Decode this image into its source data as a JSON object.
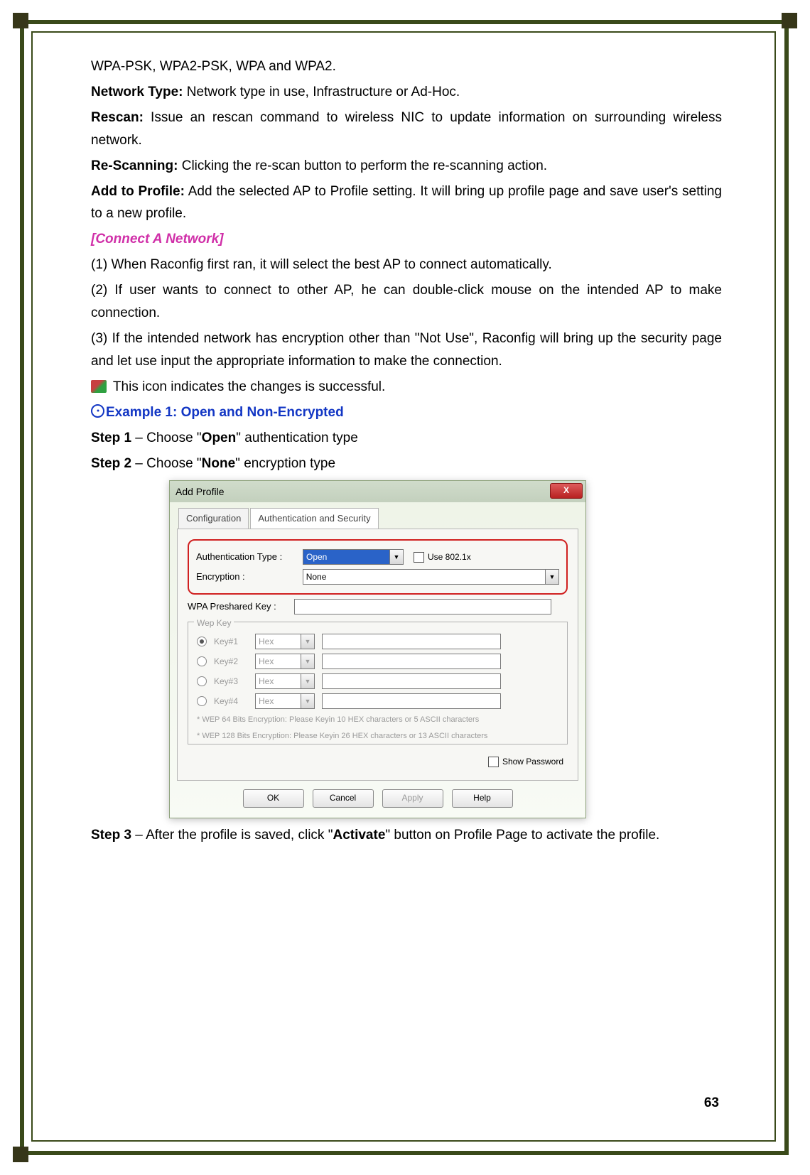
{
  "intro": {
    "line1": "WPA-PSK, WPA2-PSK, WPA and WPA2.",
    "network_type_label": "Network Type:",
    "network_type_text": " Network type in use, Infrastructure or Ad-Hoc.",
    "rescan_label": "Rescan:",
    "rescan_text": " Issue an rescan command to wireless NIC to update information on surrounding wireless network.",
    "rescanning_label": "Re-Scanning:",
    "rescanning_text": " Clicking the re-scan button to perform the re-scanning action.",
    "add_label": "Add to Profile:",
    "add_text": " Add the selected AP to Profile setting. It will bring up profile page and save user's setting to a new profile."
  },
  "connect": {
    "title": "[Connect A Network]",
    "p1": "(1) When Raconfig first ran, it will select the best AP to connect automatically.",
    "p2": "(2) If user wants to connect to other AP, he can double-click mouse on the intended AP to make connection.",
    "p3": "(3) If the intended network has encryption other than \"Not Use\", Raconfig will bring up the security page and let use input the appropriate information to make the connection.",
    "icon_note": " This icon indicates the changes is successful."
  },
  "example": {
    "title": "Example 1: Open and Non-Encrypted",
    "step1_pre": "Step 1",
    "step1_mid": " – Choose \"",
    "step1_bold": "Open",
    "step1_post": "\" authentication type",
    "step2_pre": "Step 2",
    "step2_mid": " – Choose \"",
    "step2_bold": "None",
    "step2_post": "\" encryption type",
    "step3_pre": "Step 3",
    "step3_mid": " – After the profile is saved, click \"",
    "step3_bold": "Activate",
    "step3_post": "\" button on Profile Page to activate the profile."
  },
  "dialog": {
    "title": "Add Profile",
    "close": "X",
    "tabs": [
      "Configuration",
      "Authentication and Security"
    ],
    "auth_label": "Authentication Type :",
    "auth_value": "Open",
    "use_8021x": "Use 802.1x",
    "enc_label": "Encryption :",
    "enc_value": "None",
    "wpa_label": "WPA Preshared Key :",
    "wep_legend": "Wep Key",
    "wep_keys": [
      "Key#1",
      "Key#2",
      "Key#3",
      "Key#4"
    ],
    "hex": "Hex",
    "hint1": "* WEP 64 Bits Encryption:  Please Keyin 10 HEX characters or 5 ASCII characters",
    "hint2": "* WEP 128 Bits Encryption:  Please Keyin 26 HEX characters or 13 ASCII characters",
    "show_pwd": "Show Password",
    "buttons": {
      "ok": "OK",
      "cancel": "Cancel",
      "apply": "Apply",
      "help": "Help"
    }
  },
  "page_number": "63"
}
